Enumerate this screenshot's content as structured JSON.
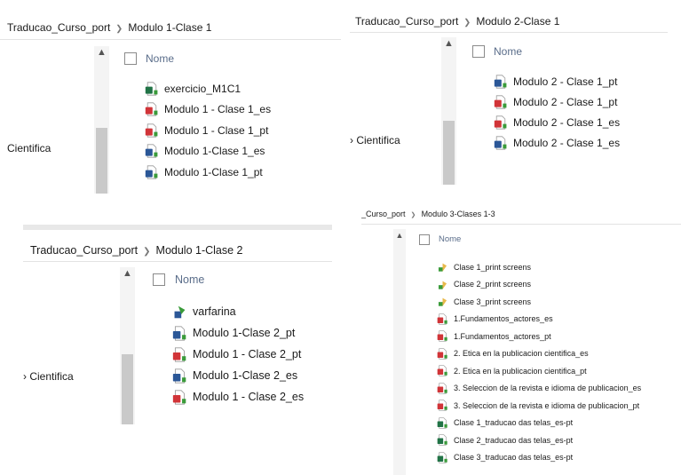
{
  "colors": {
    "word_blue": "#2b5797",
    "pdf_red": "#d13438",
    "excel_green": "#217346",
    "folder_yellow": "#e8b84a",
    "accent_green": "#3a9b3a"
  },
  "p1": {
    "breadcrumb": [
      "Traducao_Curso_port",
      "Modulo 1-Clase 1"
    ],
    "header": "Nome",
    "side_label": "Cientifica",
    "files": [
      {
        "name": "exercicio_M1C1",
        "icon": "excel-doc-icon"
      },
      {
        "name": "Modulo 1 - Clase 1_es",
        "icon": "pdf-doc-icon"
      },
      {
        "name": "Modulo 1 - Clase 1_pt",
        "icon": "pdf-doc-icon"
      },
      {
        "name": "Modulo 1-Clase 1_es",
        "icon": "word-doc-icon"
      },
      {
        "name": "Modulo 1-Clase 1_pt",
        "icon": "word-doc-icon"
      }
    ]
  },
  "p2": {
    "breadcrumb": [
      "Traducao_Curso_port",
      "Modulo 2-Clase 1"
    ],
    "header": "Nome",
    "side_label": "› Cientifica",
    "files": [
      {
        "name": "Modulo 2 - Clase 1_pt",
        "icon": "word-doc-icon"
      },
      {
        "name": "Modulo 2 - Clase 1_pt",
        "icon": "pdf-doc-icon"
      },
      {
        "name": "Modulo 2 - Clase 1_es",
        "icon": "pdf-doc-icon"
      },
      {
        "name": "Modulo 2 - Clase 1_es",
        "icon": "word-doc-icon"
      }
    ]
  },
  "p3": {
    "breadcrumb": [
      "Traducao_Curso_port",
      "Modulo 1-Clase 2"
    ],
    "header": "Nome",
    "side_label": "› Cientifica",
    "files": [
      {
        "name": "varfarina",
        "icon": "shortcut-icon"
      },
      {
        "name": "Modulo 1-Clase 2_pt",
        "icon": "word-doc-icon"
      },
      {
        "name": "Modulo 1 - Clase 2_pt",
        "icon": "pdf-doc-icon"
      },
      {
        "name": "Modulo 1-Clase 2_es",
        "icon": "word-doc-icon"
      },
      {
        "name": "Modulo 1 - Clase 2_es",
        "icon": "pdf-doc-icon"
      }
    ]
  },
  "p4": {
    "breadcrumb": [
      "_Curso_port",
      "Modulo 3-Clases 1-3"
    ],
    "header": "Nome",
    "files": [
      {
        "name": "Clase 1_print screens",
        "icon": "folder-icon"
      },
      {
        "name": "Clase 2_print screens",
        "icon": "folder-icon"
      },
      {
        "name": "Clase 3_print screens",
        "icon": "folder-icon"
      },
      {
        "name": "1.Fundamentos_actores_es",
        "icon": "pdf-doc-icon"
      },
      {
        "name": "1.Fundamentos_actores_pt",
        "icon": "pdf-doc-icon"
      },
      {
        "name": "2. Etica en la publicacion cientifica_es",
        "icon": "pdf-doc-icon"
      },
      {
        "name": "2. Etica en la publicacion cientifica_pt",
        "icon": "pdf-doc-icon"
      },
      {
        "name": "3. Seleccion de la revista e idioma de publicacion_es",
        "icon": "pdf-doc-icon"
      },
      {
        "name": "3. Seleccion de la revista e idioma de publicacion_pt",
        "icon": "pdf-doc-icon"
      },
      {
        "name": "Clase 1_traducao das telas_es-pt",
        "icon": "excel-doc-icon"
      },
      {
        "name": "Clase 2_traducao das telas_es-pt",
        "icon": "excel-doc-icon"
      },
      {
        "name": "Clase 3_traducao das telas_es-pt",
        "icon": "excel-doc-icon"
      }
    ]
  }
}
